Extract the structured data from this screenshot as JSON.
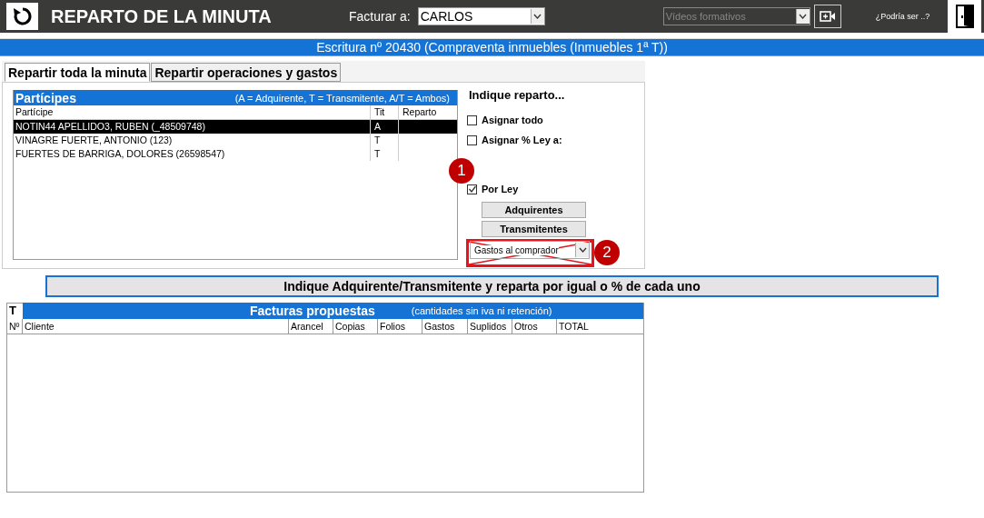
{
  "header": {
    "title": "REPARTO DE LA MINUTA",
    "bill_to_label": "Facturar a:",
    "bill_to_value": "CARLOS",
    "video_select": {
      "value": "Vídeos formativos",
      "disabled": true
    },
    "help_text": "¿Podría ser ..?"
  },
  "deed_bar": "Escritura nº 20430 (Compraventa inmuebles (Inmuebles 1ª T))",
  "tabs": [
    {
      "label": "Repartir toda la minuta",
      "selected": true
    },
    {
      "label": "Repartir operaciones y gastos",
      "selected": false
    }
  ],
  "participants": {
    "title": "Partícipes",
    "legend": "(A = Adquirente, T = Transmitente, A/T = Ambos)",
    "columns": [
      "Partícipe",
      "Tit",
      "Reparto"
    ],
    "rows": [
      {
        "name": "NOTIN44 APELLIDO3, RUBEN (_48509748)",
        "tit": "A",
        "selected": true
      },
      {
        "name": "VINAGRE FUERTE, ANTONIO (123)",
        "tit": "T",
        "selected": false
      },
      {
        "name": "FUERTES DE BARRIGA, DOLORES (26598547)",
        "tit": "T",
        "selected": false
      }
    ]
  },
  "options": {
    "heading": "Indique reparto...",
    "checkboxes": [
      {
        "label": "Asignar todo",
        "checked": false
      },
      {
        "label": "Asignar % Ley a:",
        "checked": false
      },
      {
        "label": "Por Ley",
        "checked": true
      }
    ],
    "buttons": [
      "Adquirentes",
      "Transmitentes"
    ],
    "combo": {
      "value": "Gastos al comprador",
      "crossed_out": true
    }
  },
  "annotations": [
    {
      "label": "1"
    },
    {
      "label": "2"
    }
  ],
  "banner": "Indique Adquirente/Transmitente y reparta por igual o % de cada uno",
  "invoices": {
    "t_label": "T",
    "title": "Facturas propuestas",
    "note": "(cantidades sin iva ni retención)",
    "columns": [
      "Nº",
      "Cliente",
      "Arancel",
      "Copias",
      "Folios",
      "Gastos",
      "Suplidos",
      "Otros",
      "TOTAL"
    ]
  }
}
